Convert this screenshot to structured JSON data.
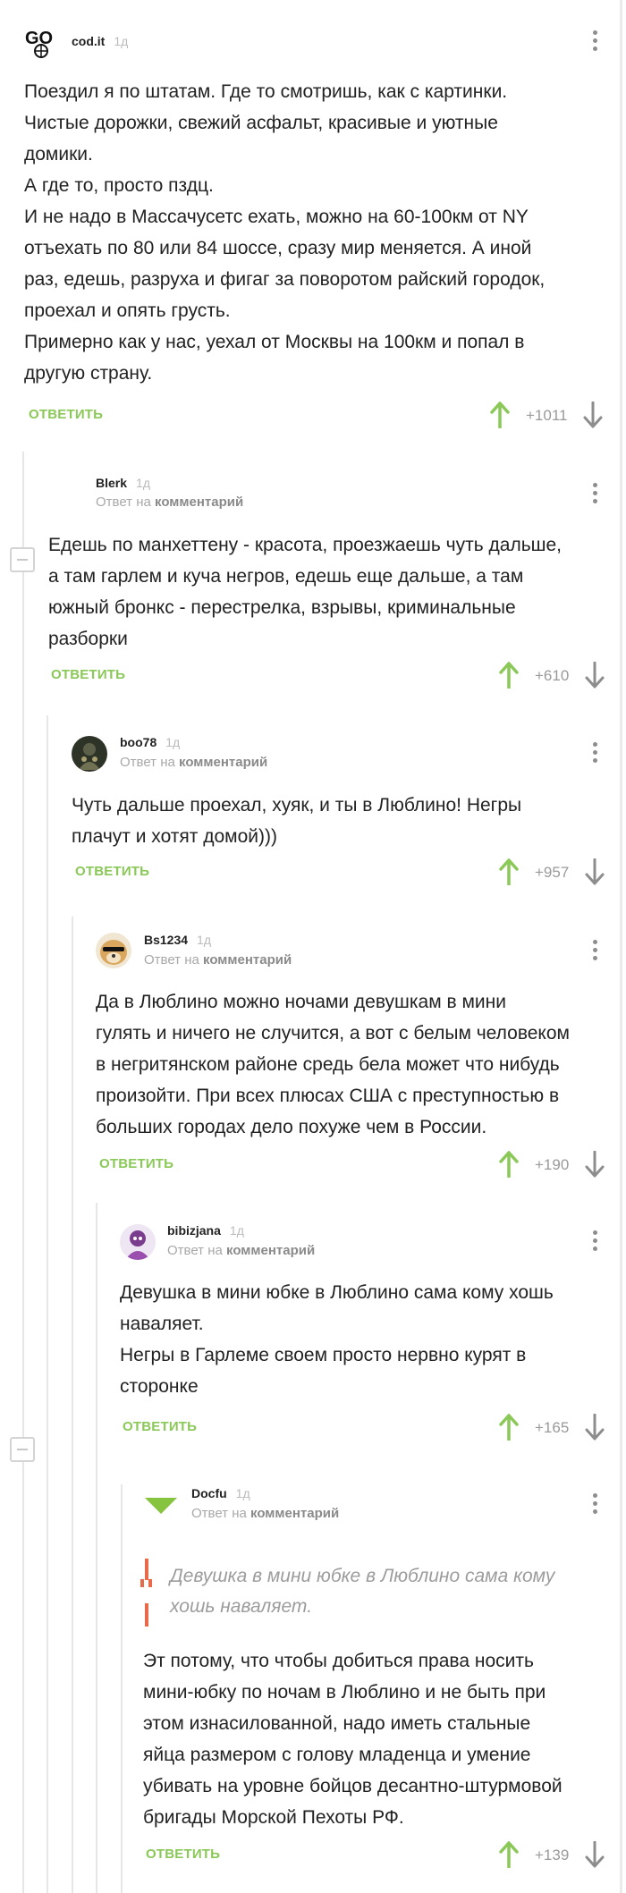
{
  "comments": [
    {
      "user": "cod.it",
      "time": "1д",
      "text": [
        "Поездил я по штатам. Где то смотришь, как с картинки.",
        "Чистые дорожки, свежий асфальт, красивые и уютные",
        "домики.",
        "А где то, просто пздц.",
        "И не надо в Массачусетс ехать, можно на 60-100км от NY",
        "отъехать по 80 или 84 шоссе, сразу мир меняется. А иной",
        "раз, едешь, разруха и фигаг за поворотом райский городок,",
        "проехал и опять грусть.",
        "Примерно как у нас, уехал от Москвы на 100км и попал в",
        "другую страну."
      ],
      "answer_label": "ОТВЕТИТЬ",
      "rating": "+1011"
    },
    {
      "user": "Blerk",
      "time": "1д",
      "reply_prefix": "Ответ на",
      "reply_target": "комментарий",
      "text": [
        "Едешь по манхеттену - красота, проезжаешь чуть дальше,",
        "а там гарлем и куча негров, едешь еще дальше, а там",
        "южный бронкс - перестрелка, взрывы, криминальные",
        "разборки"
      ],
      "answer_label": "ОТВЕТИТЬ",
      "rating": "+610"
    },
    {
      "user": "boo78",
      "time": "1д",
      "reply_prefix": "Ответ на",
      "reply_target": "комментарий",
      "text": [
        "Чуть дальше проехал, хуяк, и ты в Люблино! Негры",
        "плачут и хотят домой)))"
      ],
      "answer_label": "ОТВЕТИТЬ",
      "rating": "+957"
    },
    {
      "user": "Bs1234",
      "time": "1д",
      "reply_prefix": "Ответ на",
      "reply_target": "комментарий",
      "text": [
        "Да в Люблино можно ночами девушкам в мини",
        "гулять и ничего не случится, а вот с белым человеком",
        "в негритянском районе средь бела может что нибудь",
        "произойти. При всех плюсах США с преступностью в",
        "больших городах дело похуже чем в России."
      ],
      "answer_label": "ОТВЕТИТЬ",
      "rating": "+190"
    },
    {
      "user": "bibizjana",
      "time": "1д",
      "reply_prefix": "Ответ на",
      "reply_target": "комментарий",
      "text": [
        "Девушка в мини юбке в Люблино сама кому хошь",
        "наваляет.",
        "Негры в Гарлеме своем просто нервно курят в",
        "сторонке"
      ],
      "answer_label": "ОТВЕТИТЬ",
      "rating": "+165"
    },
    {
      "user": "Docfu",
      "time": "1д",
      "reply_prefix": "Ответ на",
      "reply_target": "комментарий",
      "quote": [
        "Девушка в мини юбке в Люблино сама кому",
        "хошь наваляет."
      ],
      "text": [
        "Эт потому, что чтобы добиться права носить",
        "мини-юбку по ночам в Люблино и не быть при",
        "этом изнасилованной, надо иметь стальные",
        "яйца размером с голову младенца и умение",
        "убивать на уровне бойцов десантно-штурмовой",
        "бригады Морской Пехоты РФ."
      ],
      "answer_label": "ОТВЕТИТЬ",
      "rating": "+139"
    }
  ],
  "colors": {
    "accent_green": "#8ac858",
    "quote_red": "#e86a4a",
    "muted": "#a8a8a8"
  },
  "icons": [
    "menu-dots-icon",
    "upvote-arrow-icon",
    "downvote-arrow-icon",
    "collapse-thread-icon",
    "quote-mark-icon"
  ]
}
